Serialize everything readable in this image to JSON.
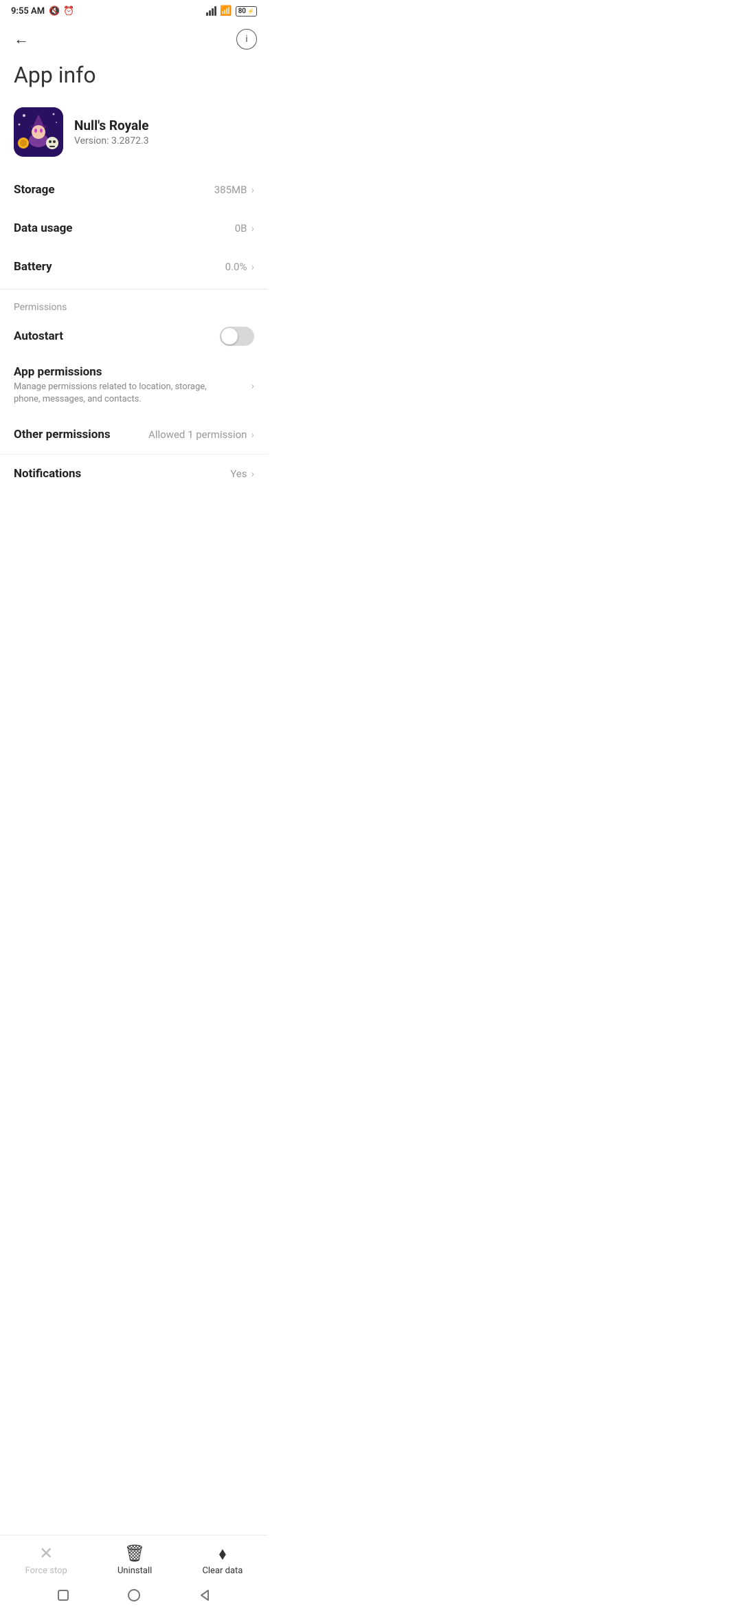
{
  "status": {
    "time": "9:55 AM",
    "battery": "80",
    "wifi": true,
    "signal": true
  },
  "nav": {
    "back_label": "←",
    "info_label": "ⓘ"
  },
  "page": {
    "title": "App info"
  },
  "app": {
    "name": "Null's Royale",
    "version": "Version: 3.2872.3"
  },
  "rows": {
    "storage_label": "Storage",
    "storage_value": "385MB",
    "data_usage_label": "Data usage",
    "data_usage_value": "0B",
    "battery_label": "Battery",
    "battery_value": "0.0%"
  },
  "permissions": {
    "section_label": "Permissions",
    "autostart_label": "Autostart",
    "app_permissions_title": "App permissions",
    "app_permissions_desc": "Manage permissions related to location, storage, phone, messages, and contacts.",
    "other_permissions_label": "Other permissions",
    "other_permissions_value": "Allowed 1 permission",
    "notifications_label": "Notifications",
    "notifications_value": "Yes"
  },
  "bottom_bar": {
    "force_stop_label": "Force stop",
    "uninstall_label": "Uninstall",
    "clear_data_label": "Clear data"
  }
}
